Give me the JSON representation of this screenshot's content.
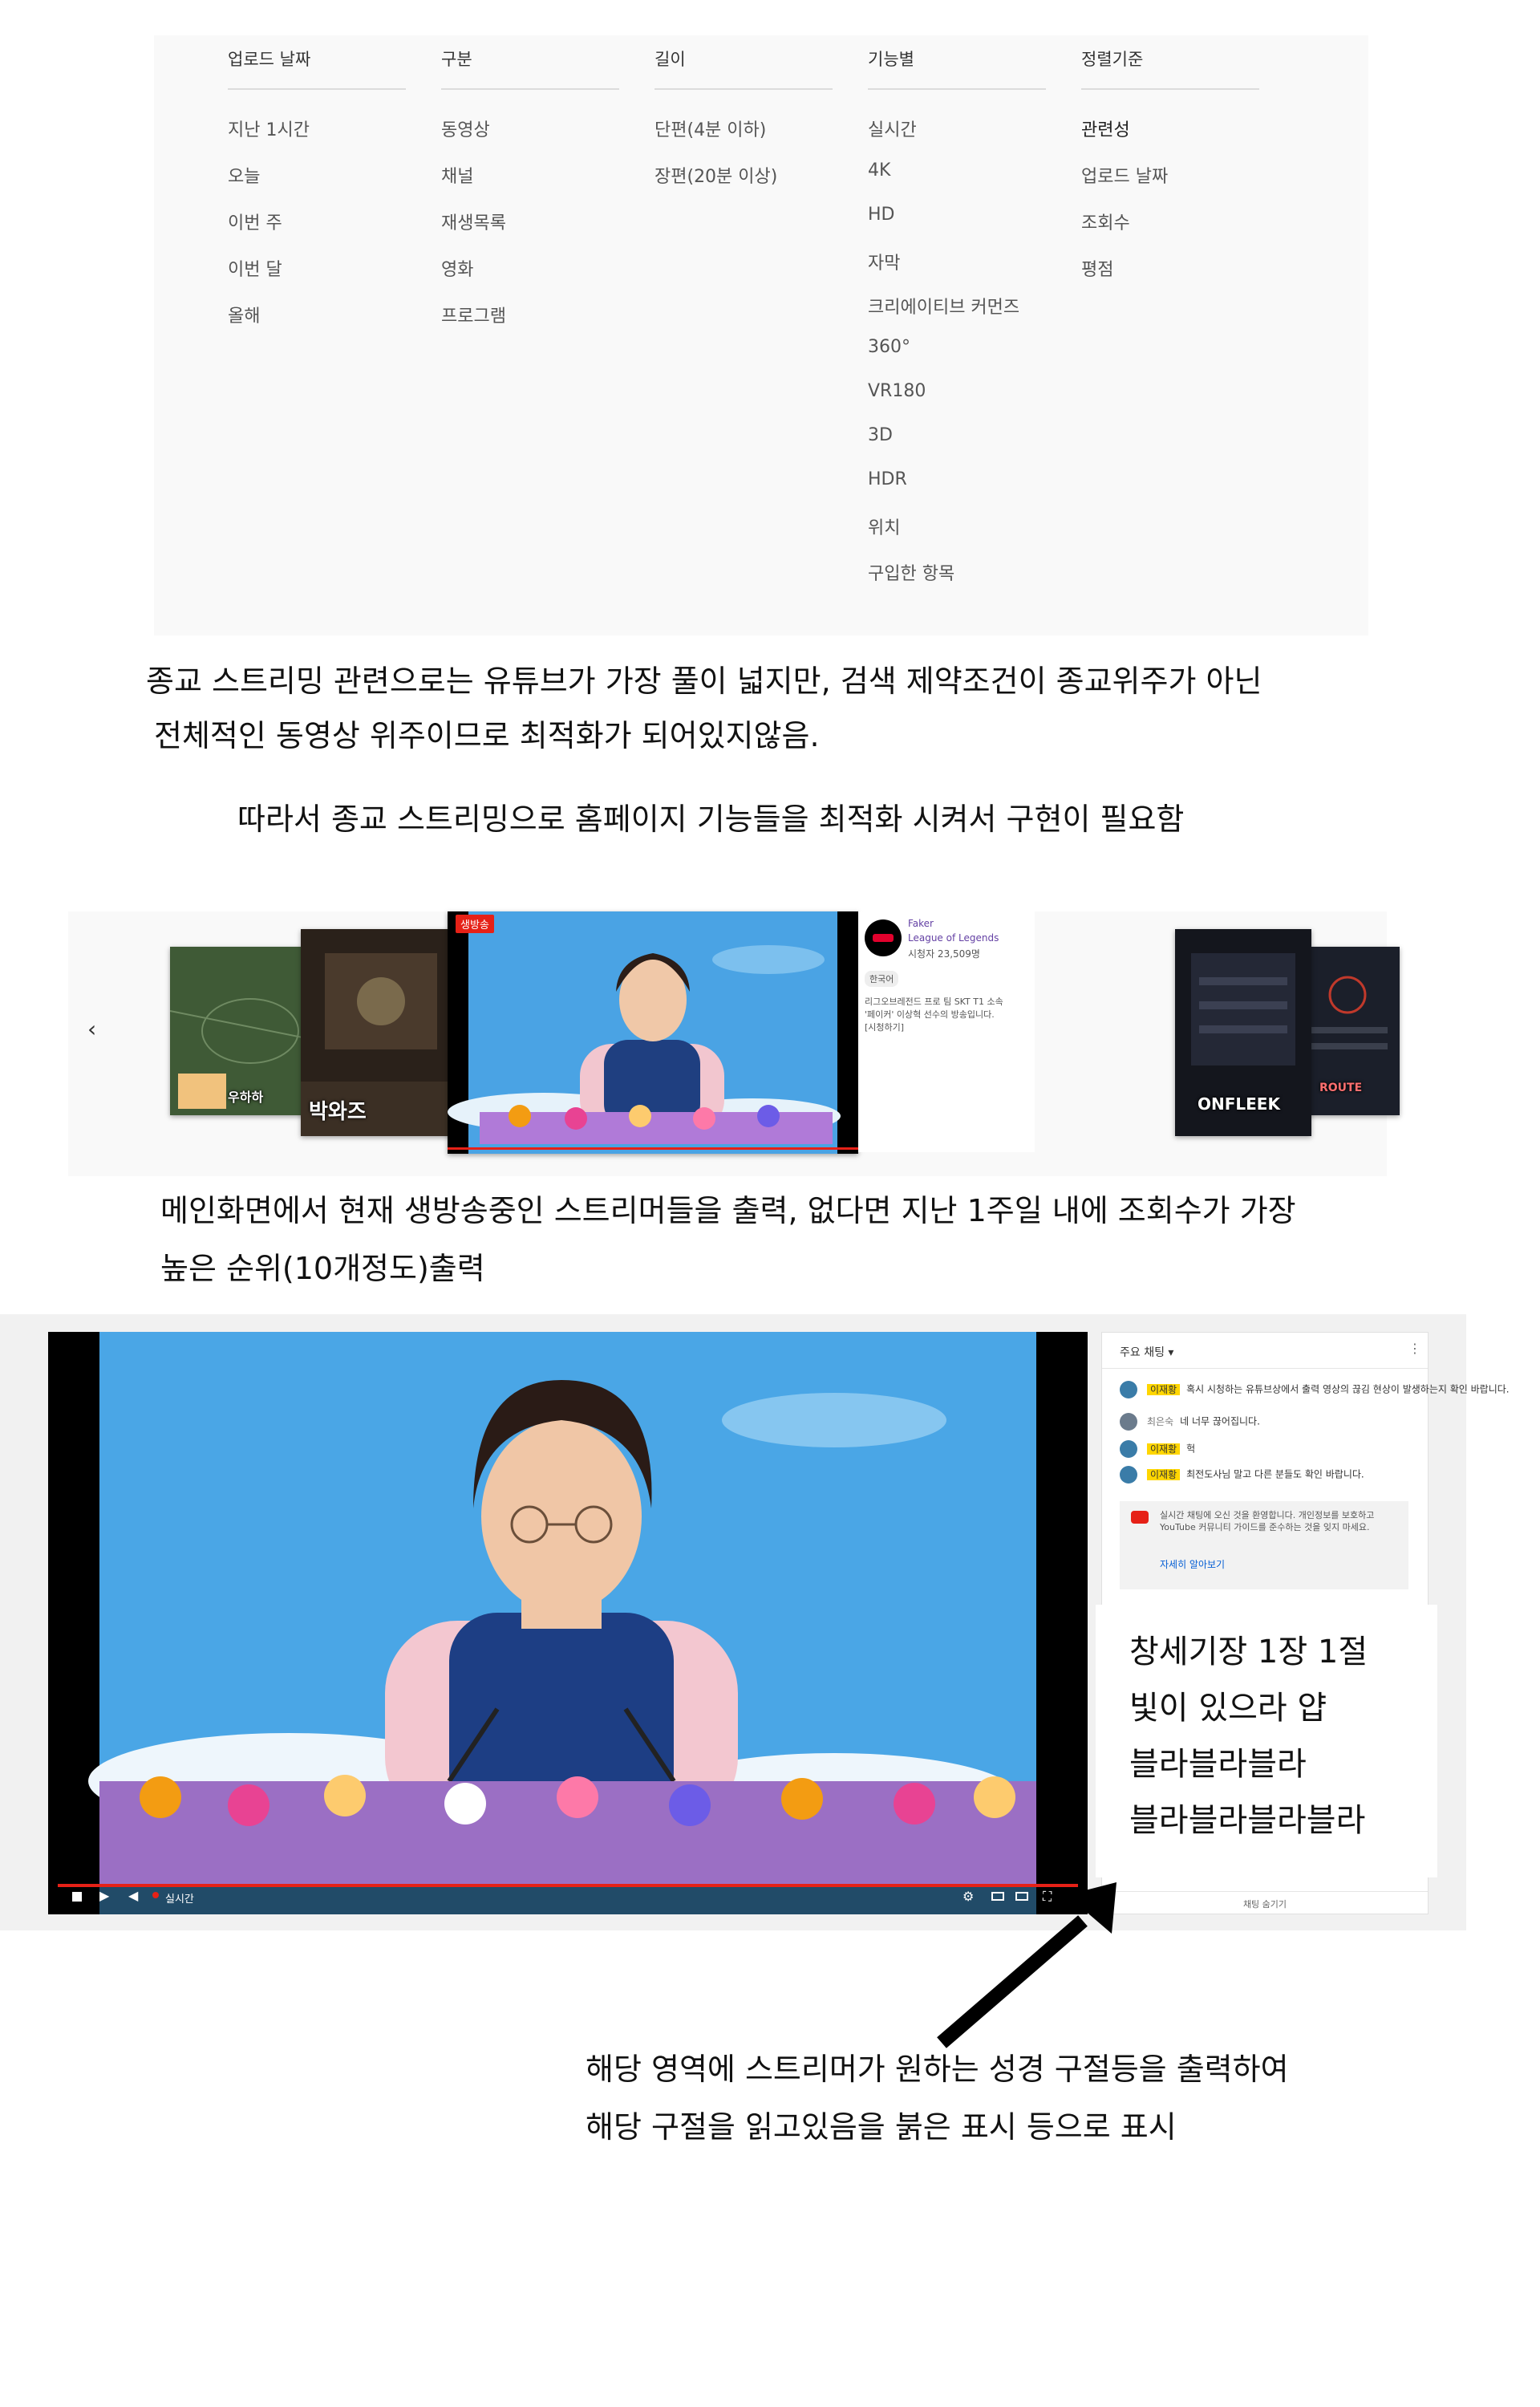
{
  "filters": {
    "columns": [
      {
        "header": "업로드 날짜",
        "items": [
          "지난 1시간",
          "오늘",
          "이번 주",
          "이번 달",
          "올해"
        ]
      },
      {
        "header": "구분",
        "items": [
          "동영상",
          "채널",
          "재생목록",
          "영화",
          "프로그램"
        ]
      },
      {
        "header": "길이",
        "items": [
          "단편(4분 이하)",
          "장편(20분 이상)"
        ]
      },
      {
        "header": "기능별",
        "items": [
          "실시간",
          "4K",
          "HD",
          "자막",
          "크리에이티브 커먼즈",
          "360°",
          "VR180",
          "3D",
          "HDR",
          "위치",
          "구입한 항목"
        ]
      },
      {
        "header": "정렬기준",
        "items": [
          "관련성",
          "업로드 날짜",
          "조회수",
          "평점"
        ]
      }
    ]
  },
  "captions": {
    "c1": "종교 스트리밍 관련으로는 유튜브가 가장 풀이 넓지만, 검색 제약조건이 종교위주가 아닌",
    "c2": "전체적인 동영상 위주이므로 최적화가 되어있지않음.",
    "c3": "따라서 종교 스트리밍으로 홈페이지 기능들을 최적화 시켜서 구현이 필요함",
    "c4": "메인화면에서 현재 생방송중인 스트리머들을 출력, 없다면 지난 1주일 내에 조회수가 가장",
    "c5": "높은 순위(10개정도)출력",
    "c6": "해당 영역에 스트리머가 원하는 성경 구절등을 출력하여",
    "c7": "해당 구절을 읽고있음을 붉은 표시 등으로 표시"
  },
  "carousel": {
    "prev": "‹",
    "next": "›",
    "live_badge": "생방송",
    "card_left_label": "박와즈",
    "card_small_label": "우하하",
    "card_right1_label": "ONFLEEK",
    "card_right2_label": "ROUTE",
    "info": {
      "name": "Faker",
      "game": "League of Legends",
      "viewers": "시청자 23,509명",
      "tag": "한국어",
      "desc1": "리그오브레전드 프로 팀 SKT T1 소속",
      "desc2": "'페이커' 이상혁 선수의 방송입니다.",
      "desc3": "[시청하기]"
    }
  },
  "player": {
    "live_label": "실시간"
  },
  "chat": {
    "header": "주요 채팅 ▾",
    "messages": [
      {
        "name": "이재황",
        "text": "혹시 시청하는 유튜브상에서 출력 영상의 끊김 현상이 발생하는지 확인 바랍니다."
      },
      {
        "name": "최은숙",
        "text": "네 너무 끊어집니다."
      },
      {
        "name": "이재황",
        "text": "헉"
      },
      {
        "name": "이재황",
        "text": "최전도사님 말고 다른 분들도 확인 바랍니다."
      }
    ],
    "notice": "실시간 채팅에 오신 것을 환영합니다. 개인정보를 보호하고 YouTube 커뮤니티 가이드를 준수하는 것을 잊지 마세요.",
    "learn_more": "자세히 알아보기",
    "hide": "채팅 숨기기"
  },
  "verse": {
    "lines": [
      "창세기장 1장 1절",
      "빛이 있으라 얍",
      "블라블라블라",
      "블라블라블라블라"
    ]
  }
}
